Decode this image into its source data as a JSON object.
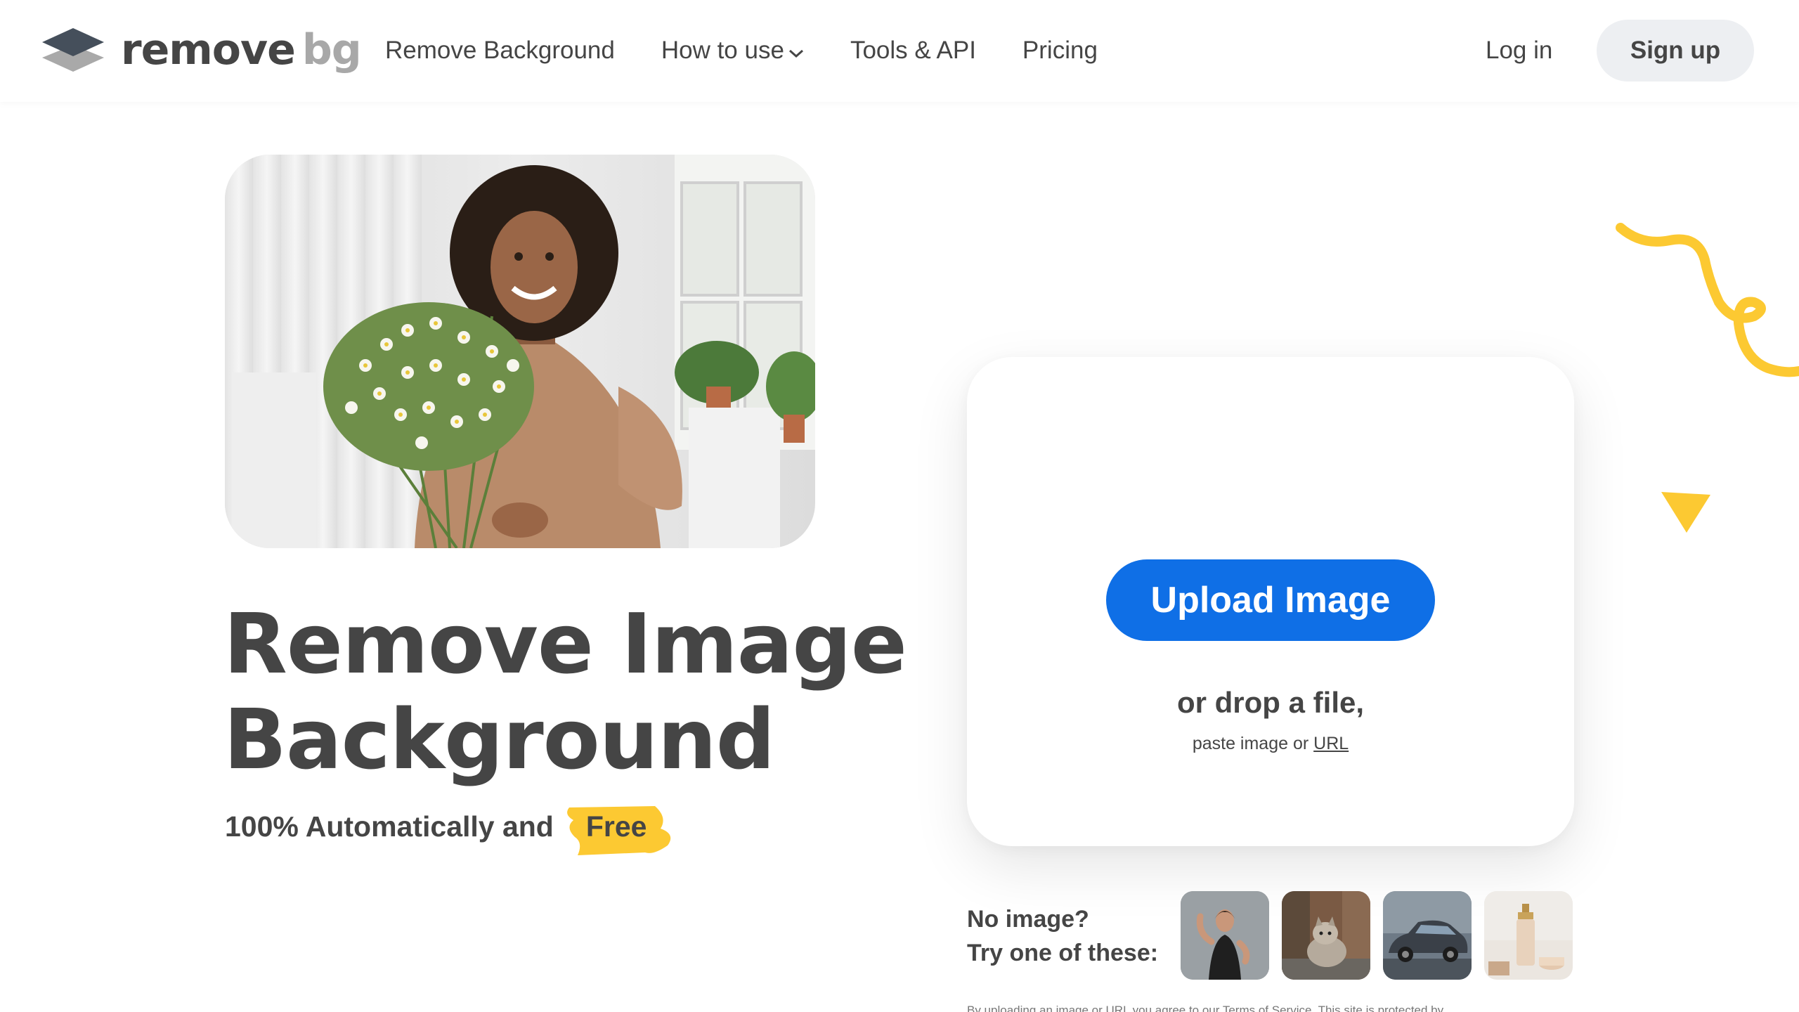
{
  "brand": {
    "name_primary": "remove",
    "name_secondary": "bg",
    "accent_color": "#0f6fe6",
    "highlight_color": "#fcc932"
  },
  "nav": {
    "items": [
      {
        "label": "Remove Background",
        "has_dropdown": false
      },
      {
        "label": "How to use",
        "has_dropdown": true
      },
      {
        "label": "Tools & API",
        "has_dropdown": false
      },
      {
        "label": "Pricing",
        "has_dropdown": false
      }
    ],
    "login_label": "Log in",
    "signup_label": "Sign up"
  },
  "hero": {
    "title_line1": "Remove Image",
    "title_line2": "Background",
    "subtitle_prefix": "100% Automatically and",
    "subtitle_highlight": "Free"
  },
  "upload": {
    "button_label": "Upload Image",
    "drop_text": "or drop a file,",
    "paste_prefix": "paste image or",
    "url_link": "URL"
  },
  "samples": {
    "label_line1": "No image?",
    "label_line2": "Try one of these:",
    "items": [
      {
        "icon": "woman-flexing-thumbnail"
      },
      {
        "icon": "cat-thumbnail"
      },
      {
        "icon": "car-thumbnail"
      },
      {
        "icon": "cosmetics-thumbnail"
      }
    ]
  },
  "footnote": "By uploading an image or URL you agree to our Terms of Service. This site is protected by"
}
